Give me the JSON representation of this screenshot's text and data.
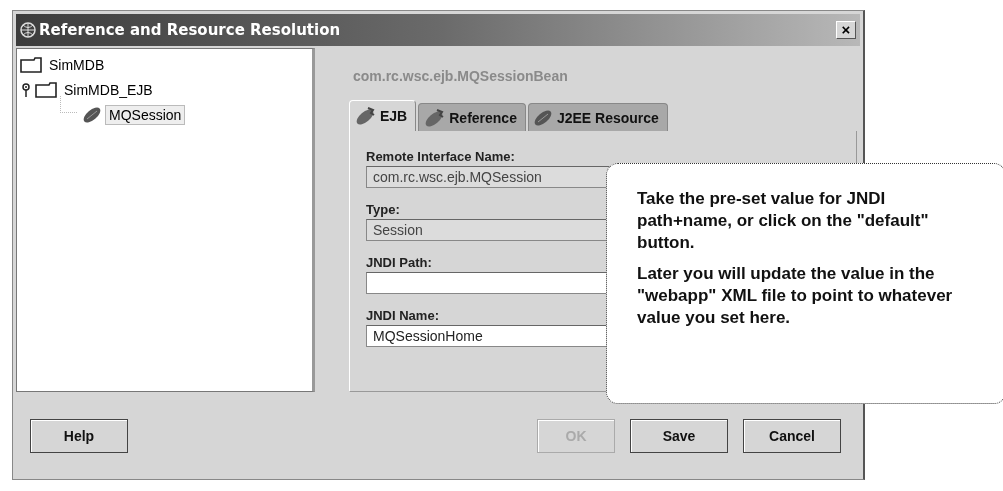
{
  "window": {
    "title": "Reference and Resource Resolution",
    "close": "×"
  },
  "tree": [
    {
      "label": "SimMDB",
      "kind": "folder",
      "selected": false
    },
    {
      "label": "SimMDB_EJB",
      "kind": "folder",
      "selected": false,
      "children": [
        {
          "label": "MQSession",
          "kind": "bean",
          "selected": true
        }
      ]
    }
  ],
  "header": "com.rc.wsc.ejb.MQSessionBean",
  "tabs": [
    {
      "label": "EJB",
      "kind": "tool",
      "selected": true
    },
    {
      "label": "Reference",
      "kind": "tool",
      "selected": false
    },
    {
      "label": "J2EE Resource",
      "kind": "bean",
      "selected": false
    }
  ],
  "fields": [
    {
      "label": "Remote Interface Name:",
      "value": "com.rc.wsc.ejb.MQSession",
      "editable": false
    },
    {
      "label": "Type:",
      "value": "Session",
      "editable": false
    },
    {
      "label": "JNDI Path:",
      "editable": true
    },
    {
      "label": "JNDI Name:",
      "value": "MQSessionHome",
      "editable": true
    }
  ],
  "buttons": [
    {
      "label": "Help",
      "disabled": false
    },
    {
      "label": "OK",
      "disabled": true
    },
    {
      "label": "Save",
      "disabled": false
    },
    {
      "label": "Cancel",
      "disabled": false
    }
  ],
  "callout": {
    "paragraphs": [
      "Take the pre-set value for JNDI path+name, or click on the \"default\" button.",
      "Later you will update the value in the \"webapp\" XML file to point to whatever value you set here."
    ]
  }
}
